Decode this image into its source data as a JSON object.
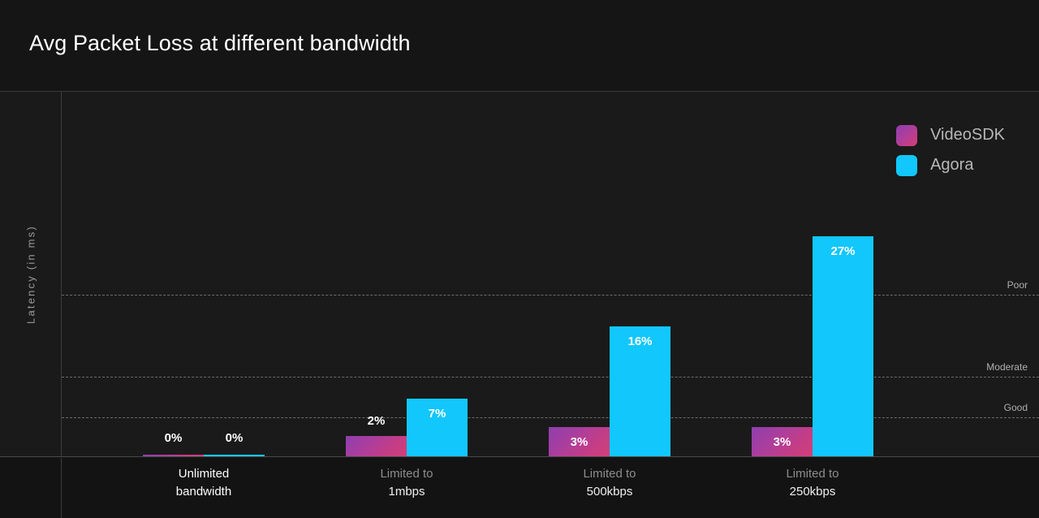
{
  "header": {
    "title": "Avg Packet Loss at different bandwidth"
  },
  "axis": {
    "y_label": "Latency (in ms)"
  },
  "legend": {
    "position": "top-right",
    "items": [
      {
        "label": "VideoSDK",
        "color": "#c43d86",
        "swatch": "videosdk-swatch"
      },
      {
        "label": "Agora",
        "color": "#12c7fb",
        "swatch": "agora-swatch"
      }
    ]
  },
  "thresholds": [
    {
      "label": "Poor",
      "y": 250
    },
    {
      "label": "Moderate",
      "y": 351
    },
    {
      "label": "Good",
      "y": 401
    }
  ],
  "categories": [
    {
      "line1": "Unlimited",
      "line2": "bandwidth",
      "active": true
    },
    {
      "line1": "Limited to",
      "line2": "1mbps",
      "active": false
    },
    {
      "line1": "Limited to",
      "line2": "500kbps",
      "active": false
    },
    {
      "line1": "Limited to",
      "line2": "250kbps",
      "active": false
    }
  ],
  "bars": [
    {
      "group": 0,
      "videosdk_label": "0%",
      "agora_label": "0%"
    },
    {
      "group": 1,
      "videosdk_label": "2%",
      "agora_label": "7%"
    },
    {
      "group": 2,
      "videosdk_label": "3%",
      "agora_label": "16%"
    },
    {
      "group": 3,
      "videosdk_label": "3%",
      "agora_label": "27%"
    }
  ],
  "chart_data": {
    "type": "bar",
    "title": "Avg Packet Loss at different bandwidth",
    "xlabel": "",
    "ylabel": "Latency (in ms)",
    "categories": [
      "Unlimited bandwidth",
      "Limited to 1mbps",
      "Limited to 500kbps",
      "Limited to 250kbps"
    ],
    "unit": "%",
    "series": [
      {
        "name": "VideoSDK",
        "color": "#c43d86",
        "values": [
          0,
          2,
          3,
          3
        ]
      },
      {
        "name": "Agora",
        "color": "#12c7fb",
        "values": [
          0,
          7,
          16,
          27
        ]
      }
    ],
    "ylim": [
      0,
      30
    ],
    "grid": "dashed-horizontal-thresholds",
    "legend_position": "top-right",
    "annotations": [
      {
        "text": "Poor",
        "type": "threshold-line",
        "value": 22
      },
      {
        "text": "Moderate",
        "type": "threshold-line",
        "value": 11
      },
      {
        "text": "Good",
        "type": "threshold-line",
        "value": 6
      }
    ],
    "data_labels": [
      [
        "0%",
        "0%"
      ],
      [
        "2%",
        "7%"
      ],
      [
        "3%",
        "16%"
      ],
      [
        "3%",
        "27%"
      ]
    ]
  },
  "colors": {
    "background": "#151515",
    "plot_background": "#1a1a1a",
    "footer_background": "#131313",
    "videosdk": "#c43d86",
    "agora": "#12c7fb",
    "axis_line": "#3d3d3d",
    "threshold_line": "#6b6b6b"
  }
}
